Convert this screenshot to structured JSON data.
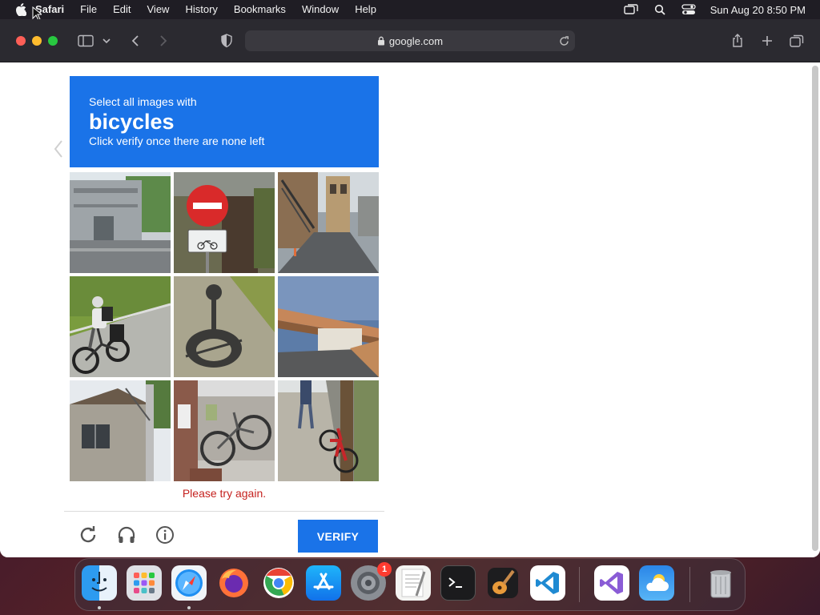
{
  "menubar": {
    "app_name": "Safari",
    "items": [
      "File",
      "Edit",
      "View",
      "History",
      "Bookmarks",
      "Window",
      "Help"
    ],
    "clock": "Sun Aug 20  8:50 PM"
  },
  "browser": {
    "url": "google.com"
  },
  "captcha": {
    "instruction_line1": "Select all images with",
    "keyword": "bicycles",
    "instruction_line3": "Click verify once there are none left",
    "error_message": "Please try again.",
    "verify_label": "VERIFY",
    "tiles": [
      {
        "id": "tile-1",
        "scene": "building with parking"
      },
      {
        "id": "tile-2",
        "scene": "no entry sign with bicycle sign"
      },
      {
        "id": "tile-3",
        "scene": "narrow street with stairs"
      },
      {
        "id": "tile-4",
        "scene": "cyclist on road"
      },
      {
        "id": "tile-5",
        "scene": "shadow of bicycle on path"
      },
      {
        "id": "tile-6",
        "scene": "overpass bridge"
      },
      {
        "id": "tile-7",
        "scene": "house with pole"
      },
      {
        "id": "tile-8",
        "scene": "parked bicycles by wall"
      },
      {
        "id": "tile-9",
        "scene": "red bicycle by tree on sidewalk"
      }
    ]
  },
  "dock": {
    "apps": [
      "Finder",
      "Launchpad",
      "Safari",
      "Firefox",
      "Chrome",
      "App Store",
      "System Settings",
      "TextEdit",
      "Terminal",
      "GarageBand",
      "Visual Studio Code",
      "Visual Studio",
      "Weather",
      "Trash"
    ],
    "settings_badge": "1"
  },
  "colors": {
    "captcha_blue": "#1a73e8",
    "error_red": "#c5221f"
  }
}
